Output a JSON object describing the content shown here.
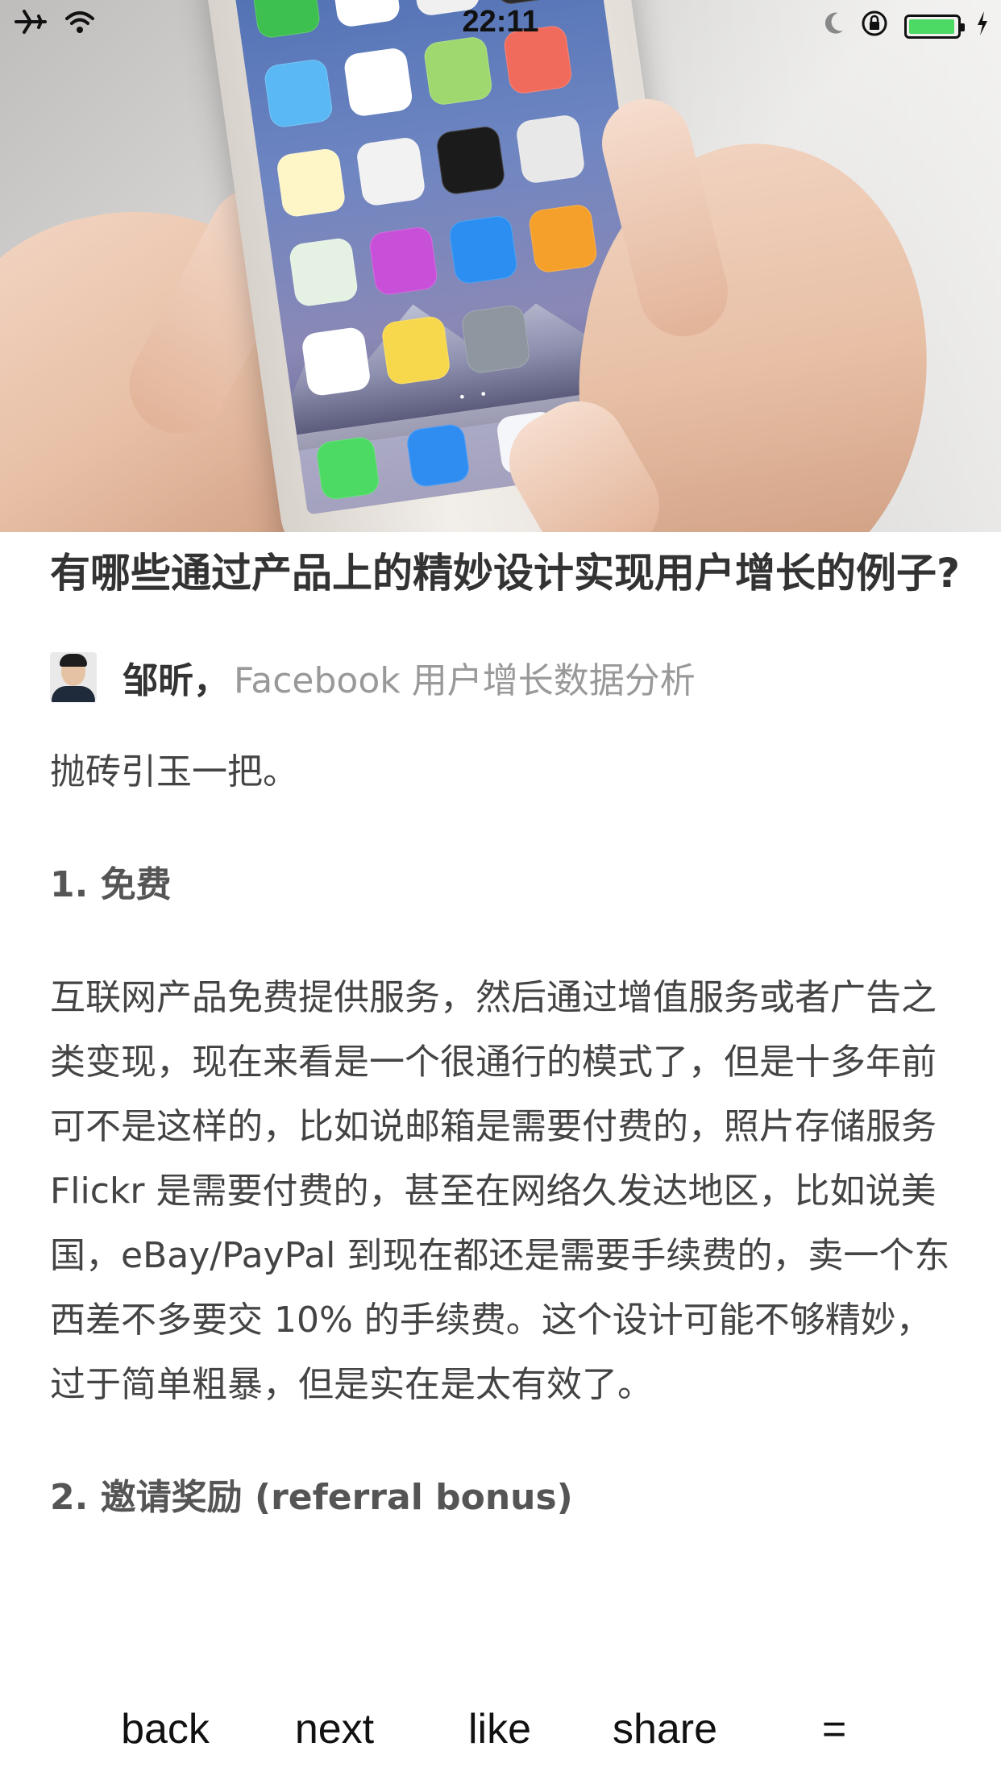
{
  "status_bar": {
    "airplane_icon": "airplane-icon",
    "wifi_icon": "wifi-icon",
    "time": "22:11",
    "moon_icon": "moon-icon",
    "rotation_lock_icon": "rotation-lock-icon",
    "battery_icon": "battery-icon",
    "charging_icon": "charging-bolt-icon",
    "battery_color": "#4cd964"
  },
  "article": {
    "title": "有哪些通过产品上的精妙设计实现用户增长的例子?",
    "author": {
      "name": "邹昕",
      "separator": "，",
      "bio": "Facebook 用户增长数据分析"
    },
    "intro": "抛砖引玉一把。",
    "section1_heading": "1. 免费",
    "section1_body": "互联网产品免费提供服务，然后通过增值服务或者广告之类变现，现在来看是一个很通行的模式了，但是十多年前可不是这样的，比如说邮箱是需要付费的，照片存储服务 Flickr 是需要付费的，甚至在网络久发达地区，比如说美国，eBay/PayPal 到现在都还是需要手续费的，卖一个东西差不多要交 10% 的手续费。这个设计可能不够精妙，过于简单粗暴，但是实在是太有效了。",
    "section2_heading": "2. 邀请奖励 (referral bonus)"
  },
  "toolbar": {
    "back_label": "back",
    "next_label": "next",
    "like_label": "like",
    "share_label": "share",
    "menu_label": "="
  },
  "colors": {
    "title_text": "#333333",
    "body_text": "#444444",
    "bio_text": "#999999"
  }
}
